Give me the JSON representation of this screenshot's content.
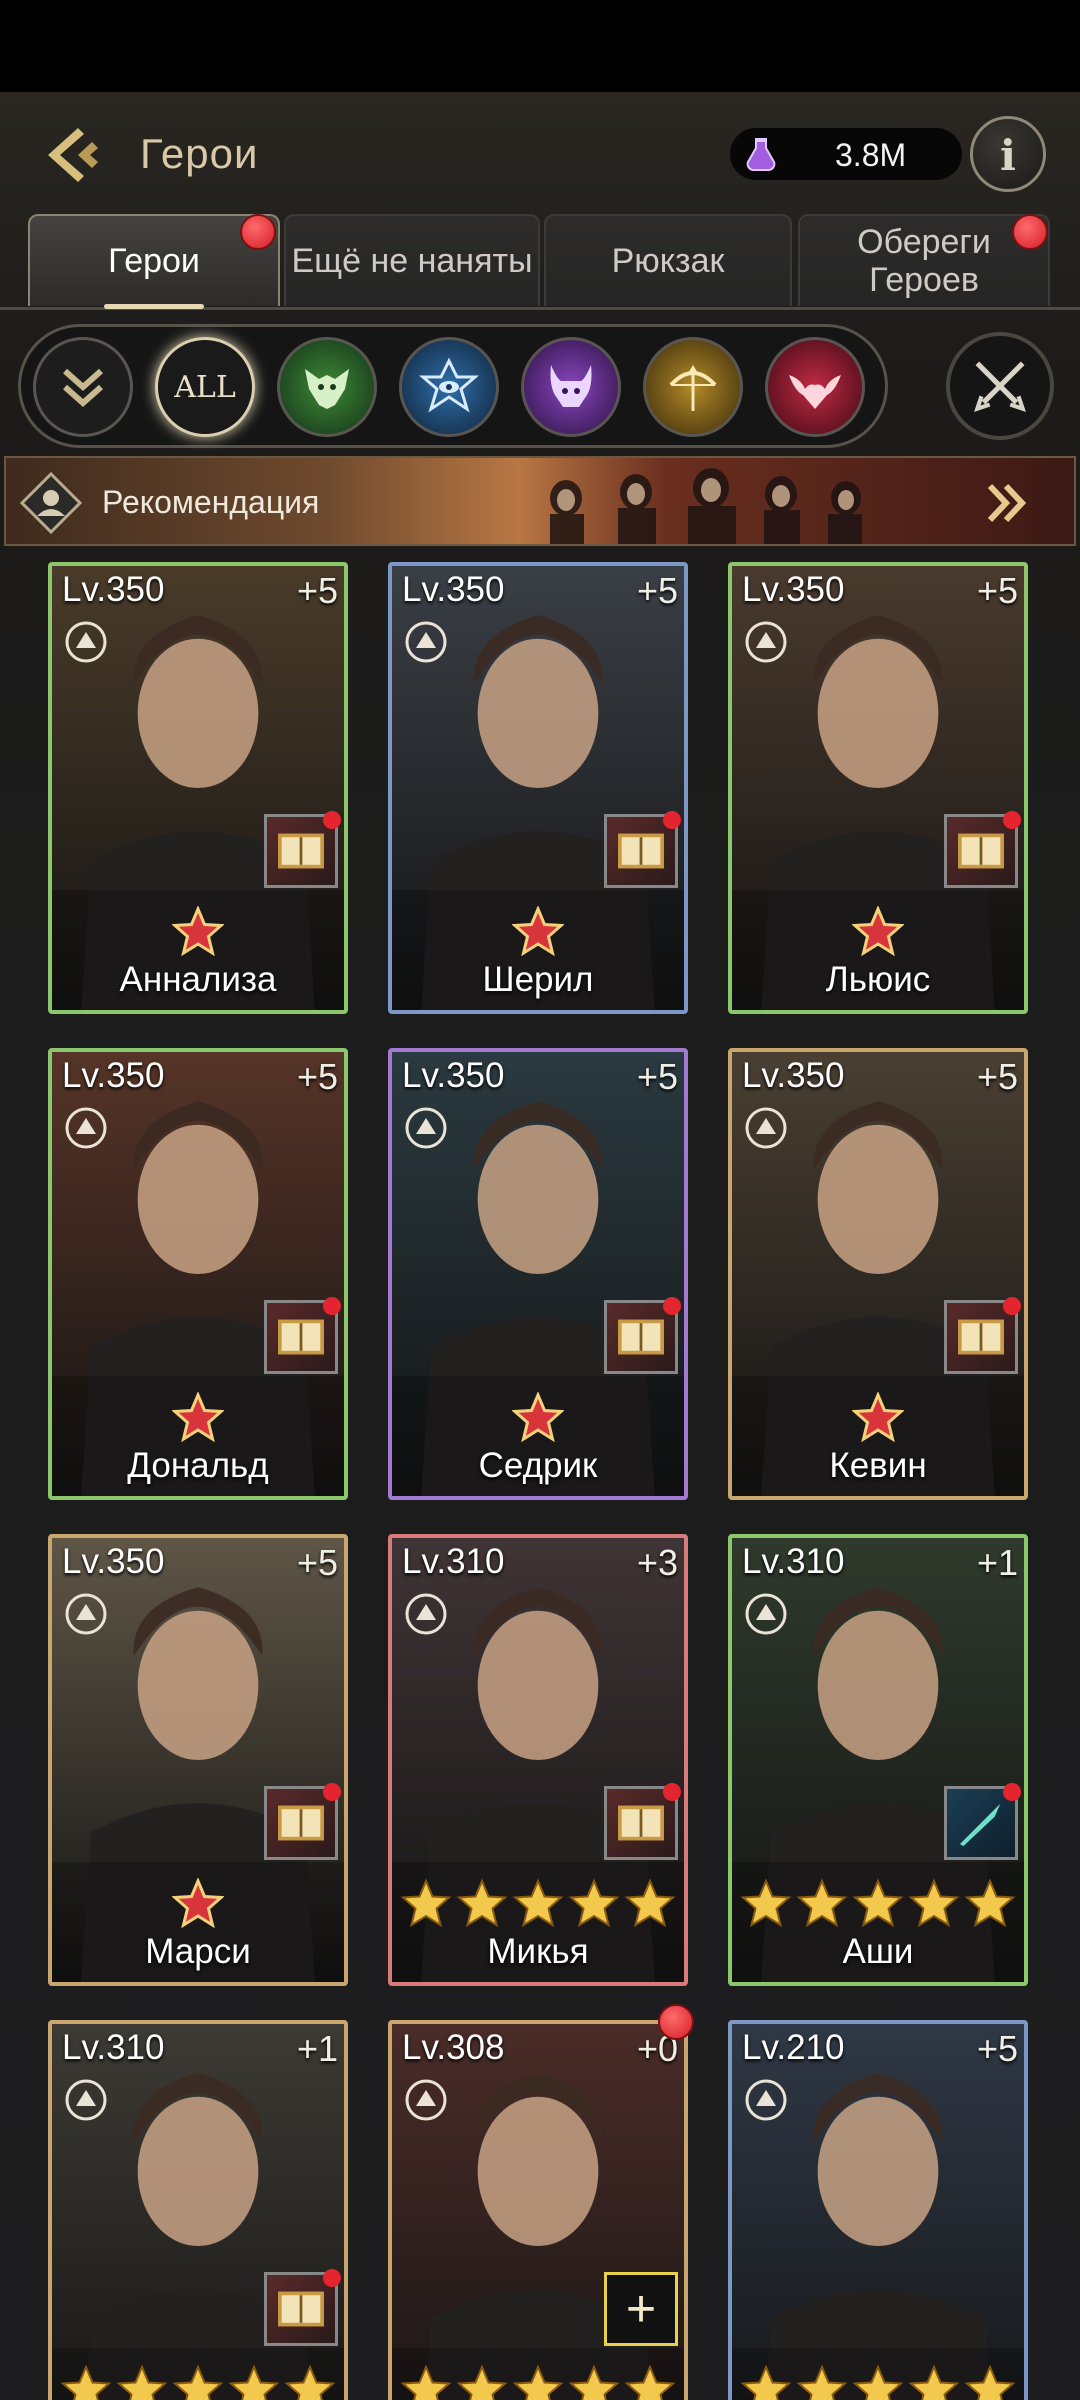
{
  "header": {
    "title": "Герои",
    "currency_value": "3.8M",
    "info_label": "i"
  },
  "tabs": [
    {
      "label": "Герои",
      "active": true,
      "badge": true
    },
    {
      "label": "Ещё не наняты",
      "active": false,
      "badge": false
    },
    {
      "label": "Рюкзак",
      "active": false,
      "badge": false
    },
    {
      "label": "Обереги Героев",
      "active": false,
      "badge": true
    }
  ],
  "filters": [
    {
      "name": "collapse",
      "icon": "double-chevron-down-icon"
    },
    {
      "name": "all",
      "label": "ALL",
      "icon": "all-icon",
      "color": "#c9b98f"
    },
    {
      "name": "wolf",
      "icon": "wolf-icon",
      "color": "#3e8a34"
    },
    {
      "name": "eye",
      "icon": "star-eye-icon",
      "color": "#2f6ea8"
    },
    {
      "name": "demon",
      "icon": "demon-icon",
      "color": "#7b3fa8"
    },
    {
      "name": "bow",
      "icon": "bow-icon",
      "color": "#a67d1f"
    },
    {
      "name": "bat",
      "icon": "bat-icon",
      "color": "#a8223a"
    }
  ],
  "recommendation": {
    "label": "Рекомендация"
  },
  "heroes": [
    {
      "level": "Lv.350",
      "plus": "+5",
      "name": "Аннализа",
      "stars": 1,
      "grade": "green",
      "bg": "#4a3b2a"
    },
    {
      "level": "Lv.350",
      "plus": "+5",
      "name": "Шерил",
      "stars": 1,
      "grade": "blue",
      "bg": "#3a3f46"
    },
    {
      "level": "Lv.350",
      "plus": "+5",
      "name": "Льюис",
      "stars": 1,
      "grade": "green",
      "bg": "#4a3a2e"
    },
    {
      "level": "Lv.350",
      "plus": "+5",
      "name": "Дональд",
      "stars": 1,
      "grade": "green",
      "bg": "#563428"
    },
    {
      "level": "Lv.350",
      "plus": "+5",
      "name": "Седрик",
      "stars": 1,
      "grade": "purple",
      "bg": "#2a3a40"
    },
    {
      "level": "Lv.350",
      "plus": "+5",
      "name": "Кевин",
      "stars": 1,
      "grade": "gold",
      "bg": "#4a3f32"
    },
    {
      "level": "Lv.350",
      "plus": "+5",
      "name": "Марси",
      "stars": 1,
      "grade": "gold",
      "bg": "#5e5546"
    },
    {
      "level": "Lv.310",
      "plus": "+3",
      "name": "Микья",
      "stars": 5,
      "grade": "red",
      "bg": "#3f3436"
    },
    {
      "level": "Lv.310",
      "plus": "+1",
      "name": "Аши",
      "stars": 5,
      "grade": "green",
      "bg": "#2f3a2c"
    },
    {
      "level": "Lv.310",
      "plus": "+1",
      "name": "",
      "stars": 5,
      "grade": "gold",
      "bg": "#3d3a34"
    },
    {
      "level": "Lv.308",
      "plus": "+0",
      "name": "",
      "stars": 5,
      "grade": "gold",
      "bg": "#4a2c28",
      "badge": true,
      "add": "+"
    },
    {
      "level": "Lv.210",
      "plus": "+5",
      "name": "",
      "stars": 5,
      "grade": "blue",
      "bg": "#2f3846"
    }
  ]
}
